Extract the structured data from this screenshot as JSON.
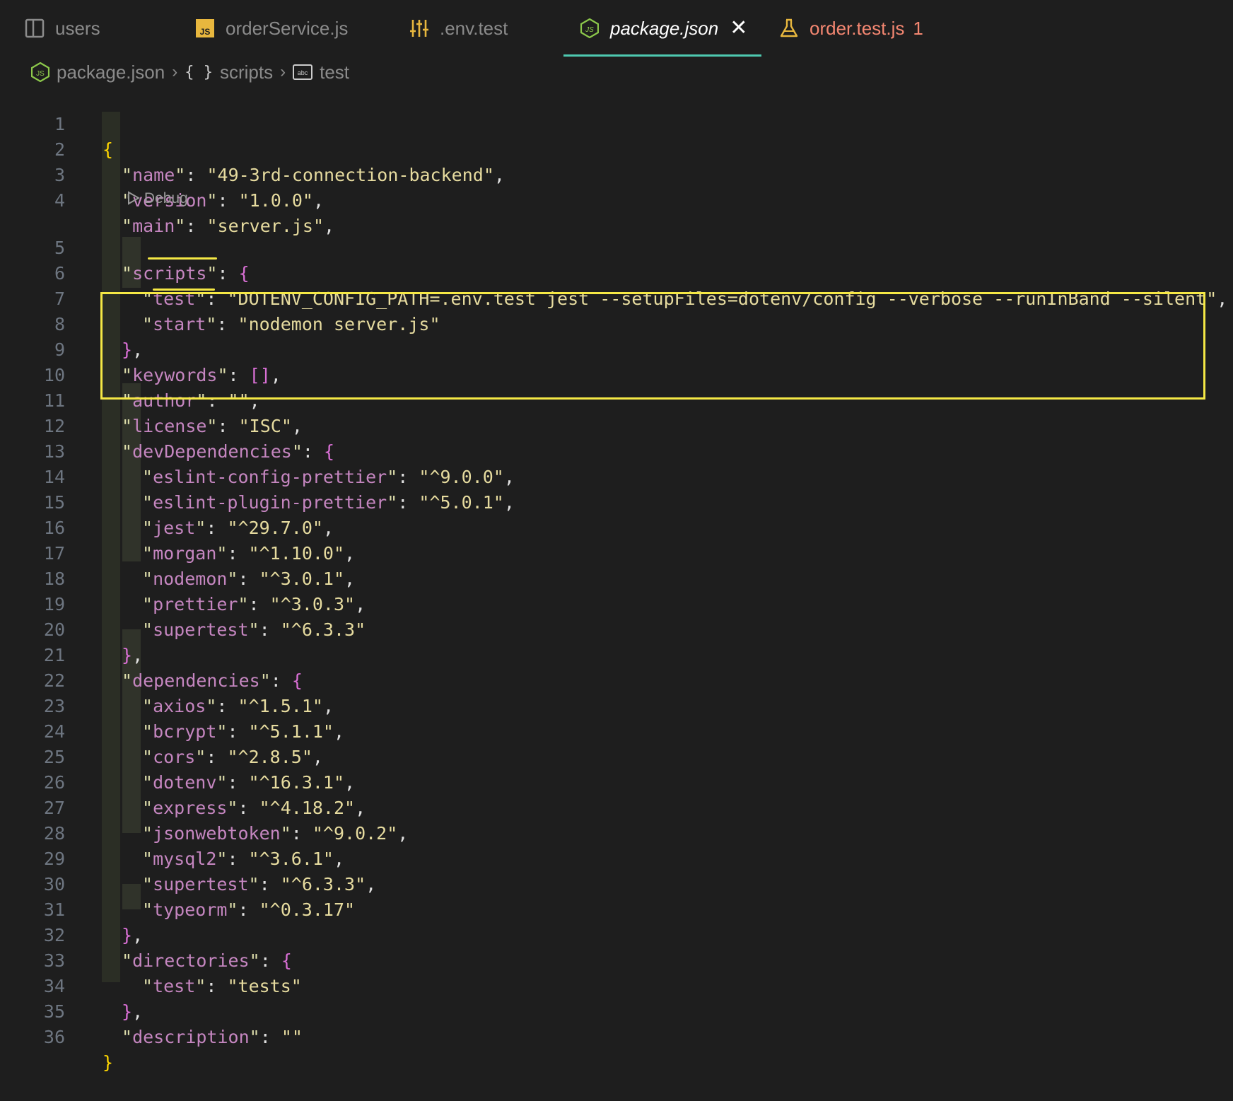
{
  "tabs": [
    {
      "label": "users",
      "icon": "split-editor-icon"
    },
    {
      "label": "orderService.js",
      "icon": "js-file-icon"
    },
    {
      "label": ".env.test",
      "icon": "settings-sliders-icon"
    },
    {
      "label": "package.json",
      "icon": "nodejs-icon",
      "active": true
    },
    {
      "label": "order.test.js",
      "icon": "flask-icon",
      "badge": "1"
    }
  ],
  "breadcrumb": {
    "file": "package.json",
    "section": "scripts",
    "leaf": "test",
    "section_icon": "{ }",
    "leaf_icon": "abc"
  },
  "codelens": {
    "label": "Debug"
  },
  "line_numbers": [
    "1",
    "2",
    "3",
    "4",
    "5",
    "6",
    "7",
    "8",
    "9",
    "10",
    "11",
    "12",
    "13",
    "14",
    "15",
    "16",
    "17",
    "18",
    "19",
    "20",
    "21",
    "22",
    "23",
    "24",
    "25",
    "26",
    "27",
    "28",
    "29",
    "30",
    "31",
    "32",
    "33",
    "34",
    "35",
    "36"
  ],
  "code": {
    "l2": {
      "key": "name",
      "value": "49-3rd-connection-backend"
    },
    "l3": {
      "key": "version",
      "value": "1.0.0"
    },
    "l4": {
      "key": "main",
      "value": "server.js"
    },
    "l5": {
      "key": "scripts"
    },
    "l6": {
      "key": "test",
      "value": "DOTENV_CONFIG_PATH=.env.test jest --setupFiles=dotenv/config --verbose --runInBand --silent"
    },
    "l7": {
      "key": "start",
      "value": "nodemon server.js"
    },
    "l9": {
      "key": "keywords"
    },
    "l10": {
      "key": "author",
      "value": ""
    },
    "l11": {
      "key": "license",
      "value": "ISC"
    },
    "l12": {
      "key": "devDependencies"
    },
    "l13": {
      "key": "eslint-config-prettier",
      "value": "^9.0.0"
    },
    "l14": {
      "key": "eslint-plugin-prettier",
      "value": "^5.0.1"
    },
    "l15": {
      "key": "jest",
      "value": "^29.7.0"
    },
    "l16": {
      "key": "morgan",
      "value": "^1.10.0"
    },
    "l17": {
      "key": "nodemon",
      "value": "^3.0.1"
    },
    "l18": {
      "key": "prettier",
      "value": "^3.0.3"
    },
    "l19": {
      "key": "supertest",
      "value": "^6.3.3"
    },
    "l21": {
      "key": "dependencies"
    },
    "l22": {
      "key": "axios",
      "value": "^1.5.1"
    },
    "l23": {
      "key": "bcrypt",
      "value": "^5.1.1"
    },
    "l24": {
      "key": "cors",
      "value": "^2.8.5"
    },
    "l25": {
      "key": "dotenv",
      "value": "^16.3.1"
    },
    "l26": {
      "key": "express",
      "value": "^4.18.2"
    },
    "l27": {
      "key": "jsonwebtoken",
      "value": "^9.0.2"
    },
    "l28": {
      "key": "mysql2",
      "value": "^3.6.1"
    },
    "l29": {
      "key": "supertest",
      "value": "^6.3.3"
    },
    "l30": {
      "key": "typeorm",
      "value": "^0.3.17"
    },
    "l32": {
      "key": "directories"
    },
    "l33": {
      "key": "test",
      "value": "tests"
    },
    "l35": {
      "key": "description",
      "value": ""
    }
  },
  "colors": {
    "background": "#1e1e1e",
    "active_tab_underline": "#4ec9b0",
    "annotation_box": "#f5e845",
    "error_tab": "#f48771"
  }
}
